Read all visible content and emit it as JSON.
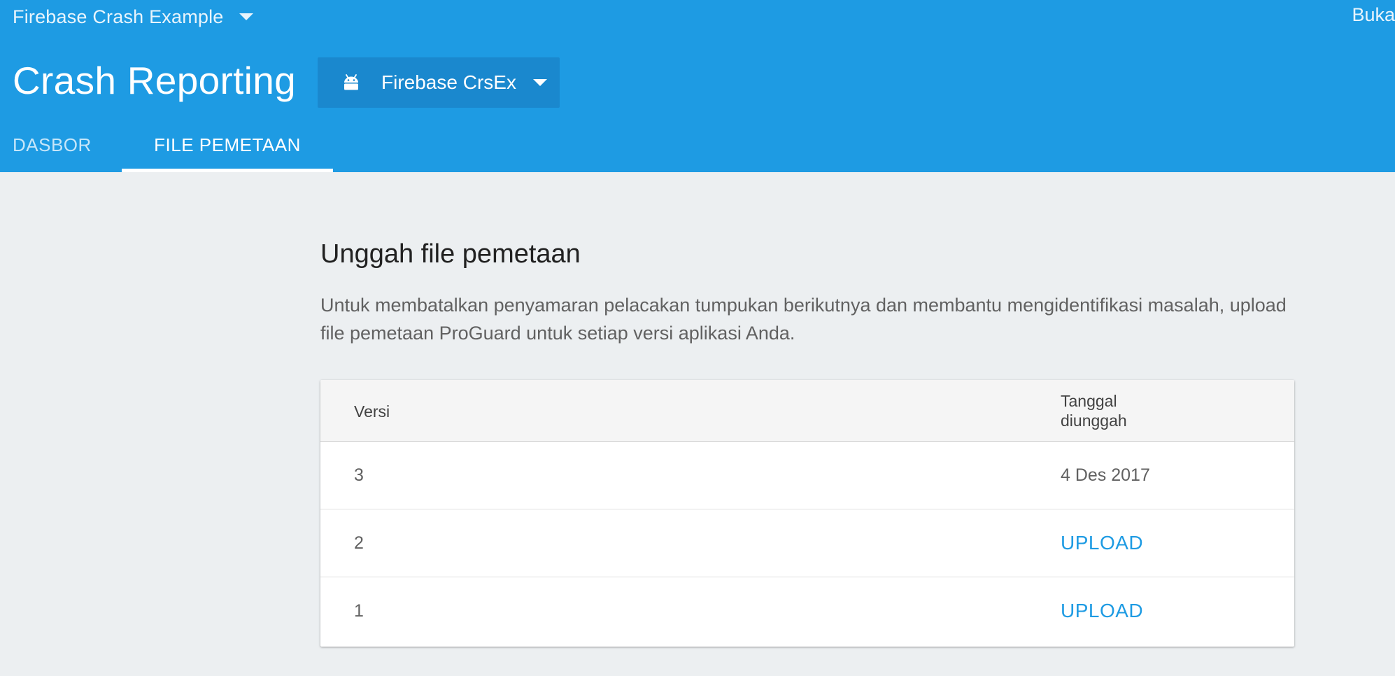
{
  "header": {
    "project_name": "Firebase Crash Example",
    "open_link": "Buka",
    "page_title": "Crash Reporting",
    "app_selector": {
      "icon": "android-icon",
      "label": "Firebase CrsEx"
    },
    "tabs": [
      {
        "label": "DASBOR",
        "active": false
      },
      {
        "label": "FILE PEMETAAN",
        "active": true
      }
    ]
  },
  "main": {
    "heading": "Unggah file pemetaan",
    "description": "Untuk membatalkan penyamaran pelacakan tumpukan berikutnya dan membantu mengidentifikasi masalah, upload file pemetaan ProGuard untuk setiap versi aplikasi Anda.",
    "table": {
      "columns": [
        "Versi",
        "Tanggal diunggah"
      ],
      "rows": [
        {
          "version": "3",
          "uploaded": "4 Des 2017",
          "action": ""
        },
        {
          "version": "2",
          "uploaded": "",
          "action": "UPLOAD"
        },
        {
          "version": "1",
          "uploaded": "",
          "action": "UPLOAD"
        }
      ]
    }
  },
  "colors": {
    "header_bg": "#1e9be3",
    "app_selector_bg": "#1a88ce",
    "page_bg": "#eceff1",
    "accent": "#1e9be3"
  }
}
